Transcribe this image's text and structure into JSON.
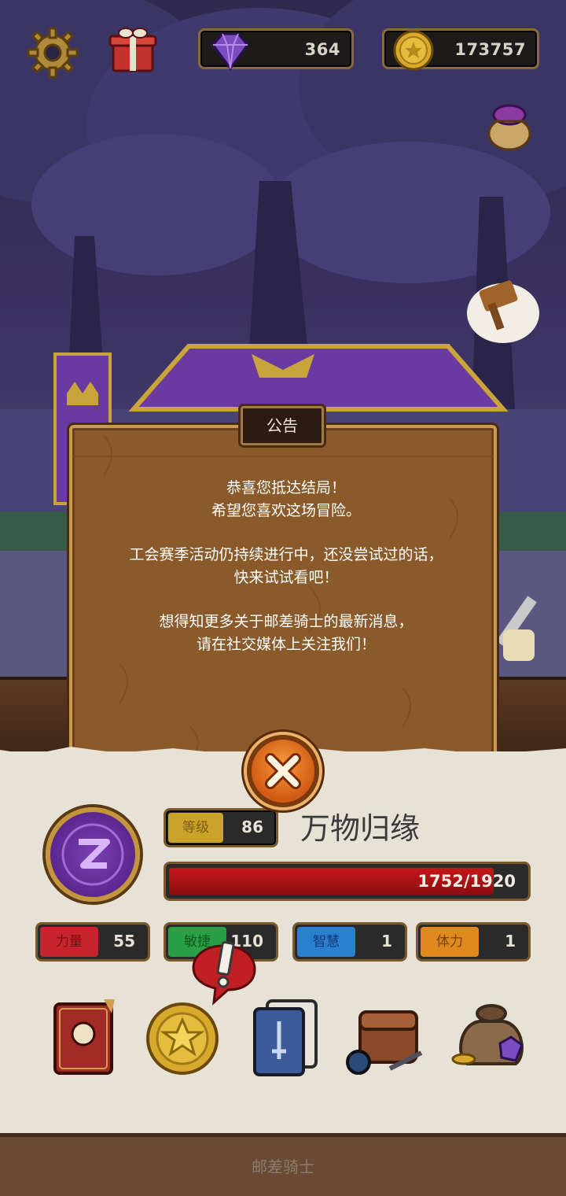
{
  "hud": {
    "gems": "364",
    "coins": "173757",
    "settings_icon": "gear-icon",
    "gift_icon": "gift-icon",
    "gem_icon": "purple-gem-icon",
    "coin_icon": "gold-coin-icon",
    "loot_icon": "treasure-sack-icon"
  },
  "dialog": {
    "title": "公告",
    "lines": [
      "恭喜您抵达结局！",
      "希望您喜欢这场冒险。",
      "工会赛季活动仍持续进行中，还没尝试过的话，",
      "快来试试看吧！",
      "想得知更多关于邮差骑士的最新消息，",
      "请在社交媒体上关注我们！"
    ],
    "close_icon": "close-x-icon"
  },
  "player": {
    "name": "万物归缘",
    "level_label": "等级",
    "level": "86",
    "hp_text": "1752/1920",
    "hp_fraction": 0.9125,
    "avatar_icon": "guild-emblem-icon"
  },
  "stats": [
    {
      "label": "力量",
      "value": "55",
      "color": "#c8242e",
      "text": "#7a0d12"
    },
    {
      "label": "敏捷",
      "value": "110",
      "color": "#2aa046",
      "text": "#0d5a20"
    },
    {
      "label": "智慧",
      "value": "1",
      "color": "#2a7fd0",
      "text": "#0d3a70"
    },
    {
      "label": "体力",
      "value": "1",
      "color": "#e08a1e",
      "text": "#7a4206"
    }
  ],
  "menu": [
    "quest-book-icon",
    "gold-star-coin-icon",
    "card-deck-icon",
    "inventory-bag-icon",
    "treasure-loot-icon"
  ],
  "footer": {
    "title": "邮差骑士"
  }
}
